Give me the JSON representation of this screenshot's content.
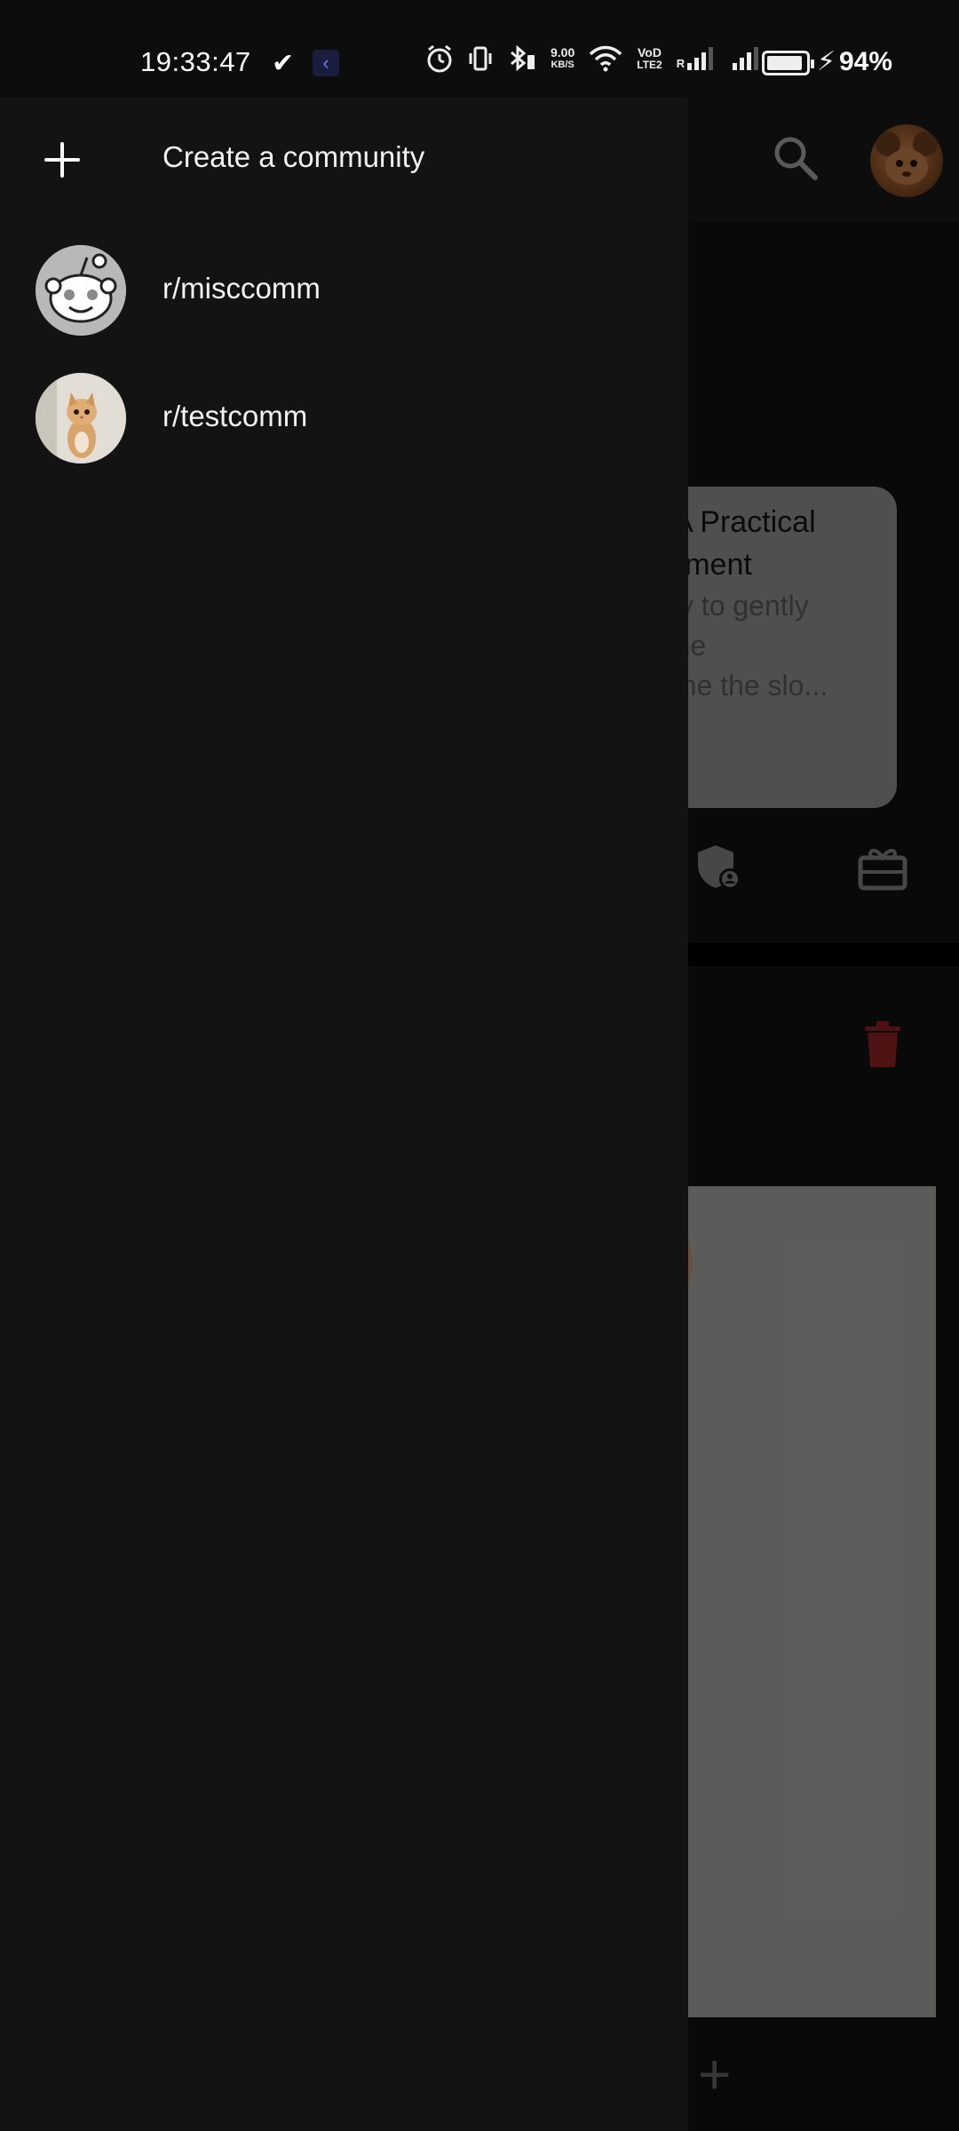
{
  "status_bar": {
    "time": "19:33:47",
    "net_speed_top": "9.00",
    "net_speed_bottom": "KB/S",
    "volte_top": "VoD",
    "volte_bottom": "LTE2",
    "roaming": "R",
    "battery_percent": "94%",
    "battery_level": 0.94
  },
  "drawer": {
    "create_label": "Create a community",
    "communities": [
      {
        "name": "r/misccomm",
        "icon": "reddit-snoo-icon"
      },
      {
        "name": "r/testcomm",
        "icon": "kitten-photo"
      }
    ]
  },
  "background": {
    "card_title_line1": "s: A Practical",
    "card_title_line2": "Moment",
    "card_body_line1": "way to gently",
    "card_body_line2": "n the",
    "card_body_line3": "come the slo..."
  },
  "colors": {
    "drawer_bg": "#131313",
    "delete_red": "#c62828"
  }
}
